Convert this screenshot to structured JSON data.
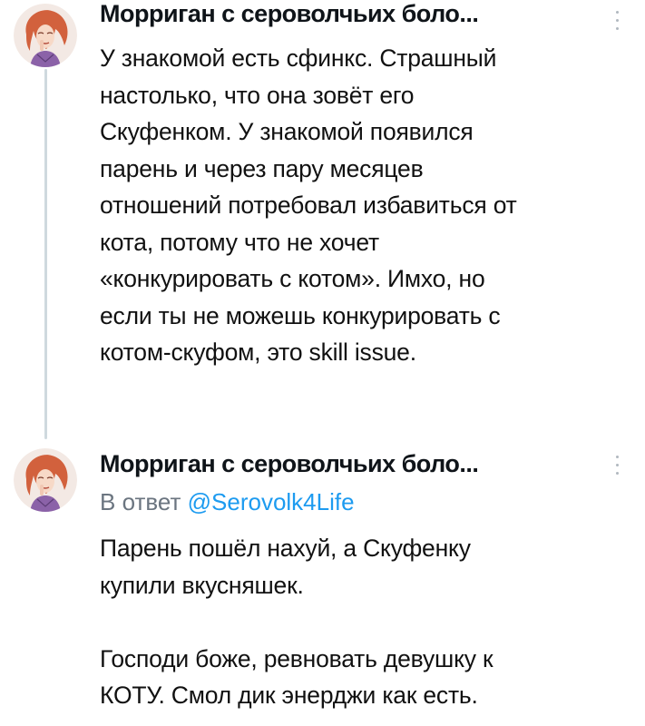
{
  "tweets": [
    {
      "author": "Морриган с сероволчьих боло...",
      "avatar_icon": "avatar-portrait-icon",
      "more_icon": "vertical-dots-icon",
      "lines": [
        "У знакомой есть сфинкс. Страшный",
        "настолько, что она зовёт его",
        "Скуфенком. У знакомой появился",
        "парень и через пару месяцев",
        "отношений потребовал избавиться от",
        "кота, потому что не хочет",
        "«конкурировать с котом». Имхо, но",
        "если ты не можешь конкурировать с",
        "котом-скуфом, это skill issue."
      ]
    },
    {
      "author": "Морриган с сероволчьих боло...",
      "avatar_icon": "avatar-portrait-icon",
      "more_icon": "vertical-dots-icon",
      "reply_prefix": "В ответ ",
      "reply_handle": "@Serovolk4Life",
      "paragraphs": [
        [
          "Парень пошёл нахуй, а Скуфенку",
          "купили вкусняшек."
        ],
        [
          "Господи боже, ревновать девушку к",
          "КОТУ. Смол дик энерджи как есть."
        ]
      ]
    }
  ],
  "colors": {
    "link": "#1d9bf0",
    "muted": "#6b7580",
    "thread_line": "#cfd9de"
  }
}
